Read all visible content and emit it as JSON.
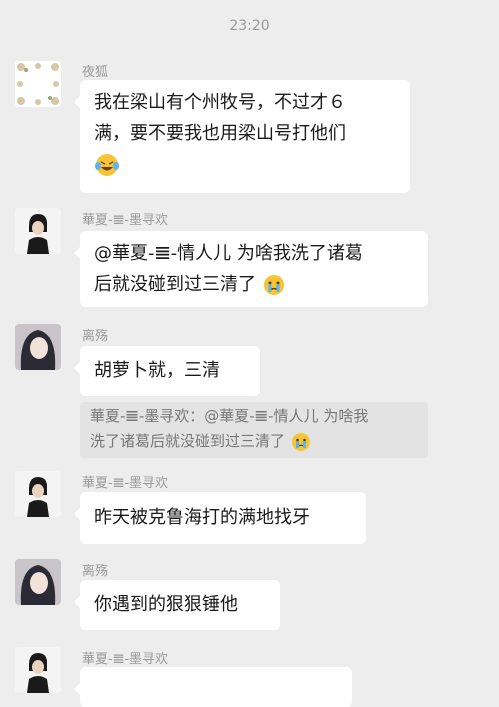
{
  "timestamp": "23:20",
  "messages": [
    {
      "sender": "夜狐",
      "lines": [
        "我在梁山有个州牧号，不过才６",
        "满，要不要我也用梁山号打他们"
      ],
      "emoji": "laughing-tears-emoji"
    },
    {
      "sender": "華夏-𝌆-墨寻欢",
      "lines": [
        "@華夏-𝌆-情人儿 为啥我洗了诸葛",
        "后就没碰到过三清了"
      ],
      "emoji": "crying-face-emoji"
    },
    {
      "sender": "离殇",
      "lines": [
        "胡萝卜就，三清"
      ]
    },
    {
      "quote_lines": [
        "華夏-𝌆-墨寻欢：@華夏-𝌆-情人儿 为啥我",
        "洗了诸葛后就没碰到过三清了"
      ],
      "emoji": "crying-face-emoji"
    },
    {
      "sender": "華夏-𝌆-墨寻欢",
      "lines": [
        "昨天被克鲁海打的满地找牙"
      ]
    },
    {
      "sender": "离殇",
      "lines": [
        "你遇到的狠狠锤他"
      ]
    },
    {
      "sender": "華夏-𝌆-墨寻欢"
    }
  ]
}
